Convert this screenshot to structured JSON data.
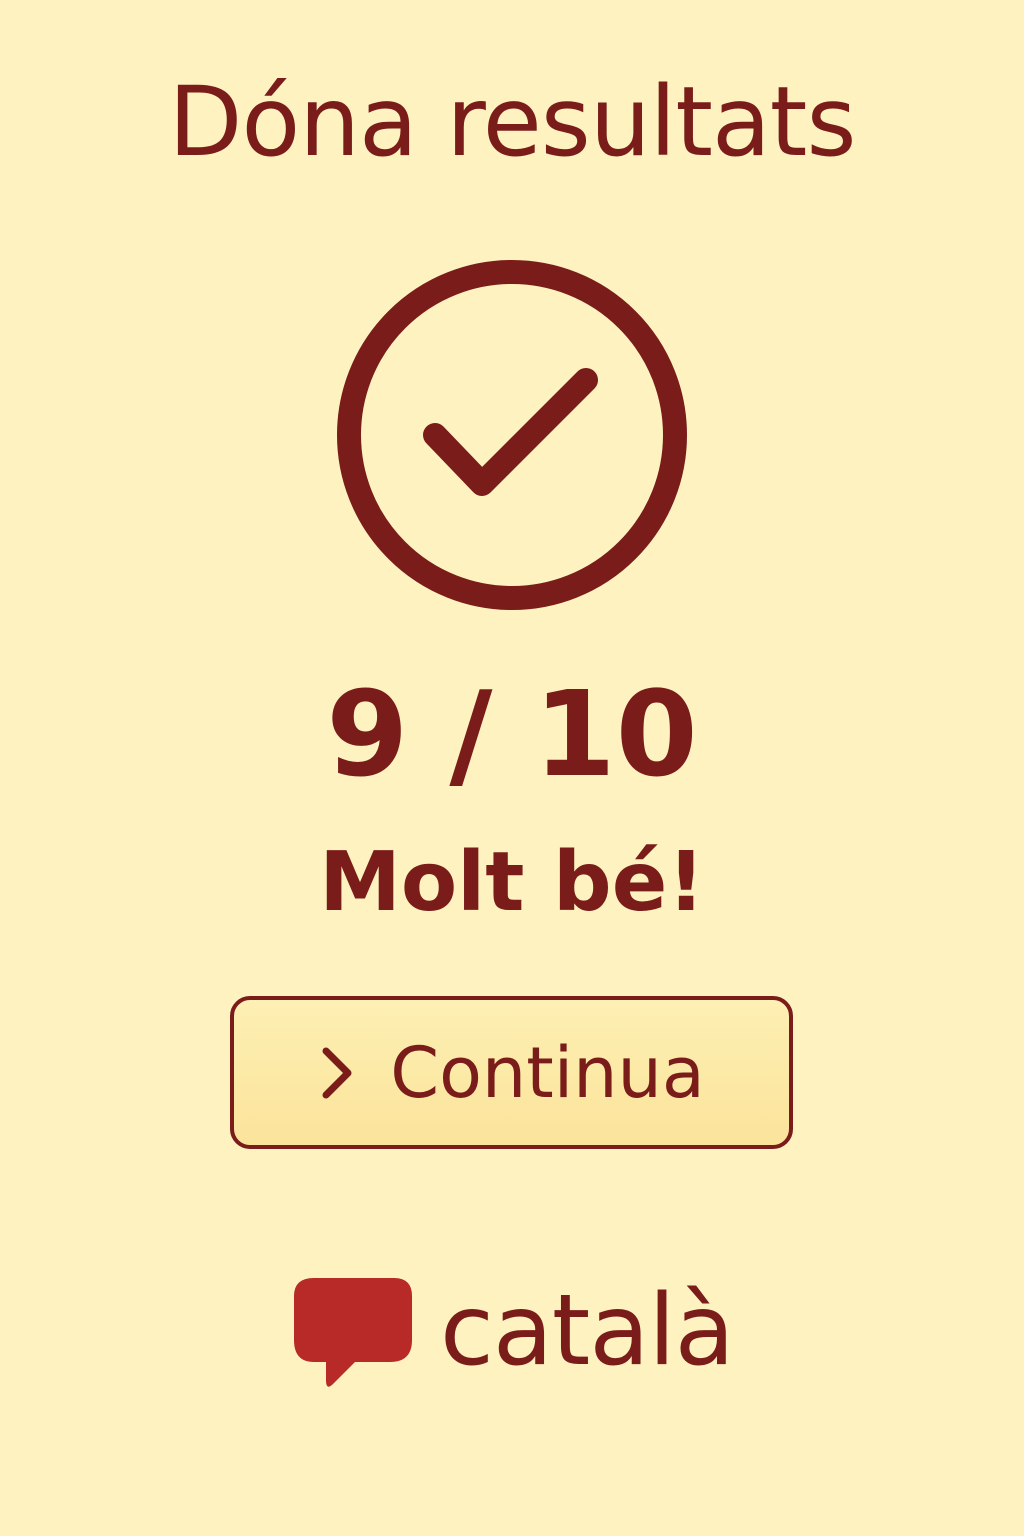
{
  "theme": {
    "background": "#fdf2c0",
    "accent": "#7a1c1a",
    "brand": "#b82a27"
  },
  "header": {
    "title": "Dóna resultats"
  },
  "result": {
    "icon": "check-circle-icon",
    "score": "9 / 10",
    "message": "Molt bé!"
  },
  "actions": {
    "continue_label": "Continua",
    "continue_icon": "chevron-right-icon"
  },
  "brand": {
    "logo_icon": "speech-bubble-icon",
    "name": "català"
  }
}
